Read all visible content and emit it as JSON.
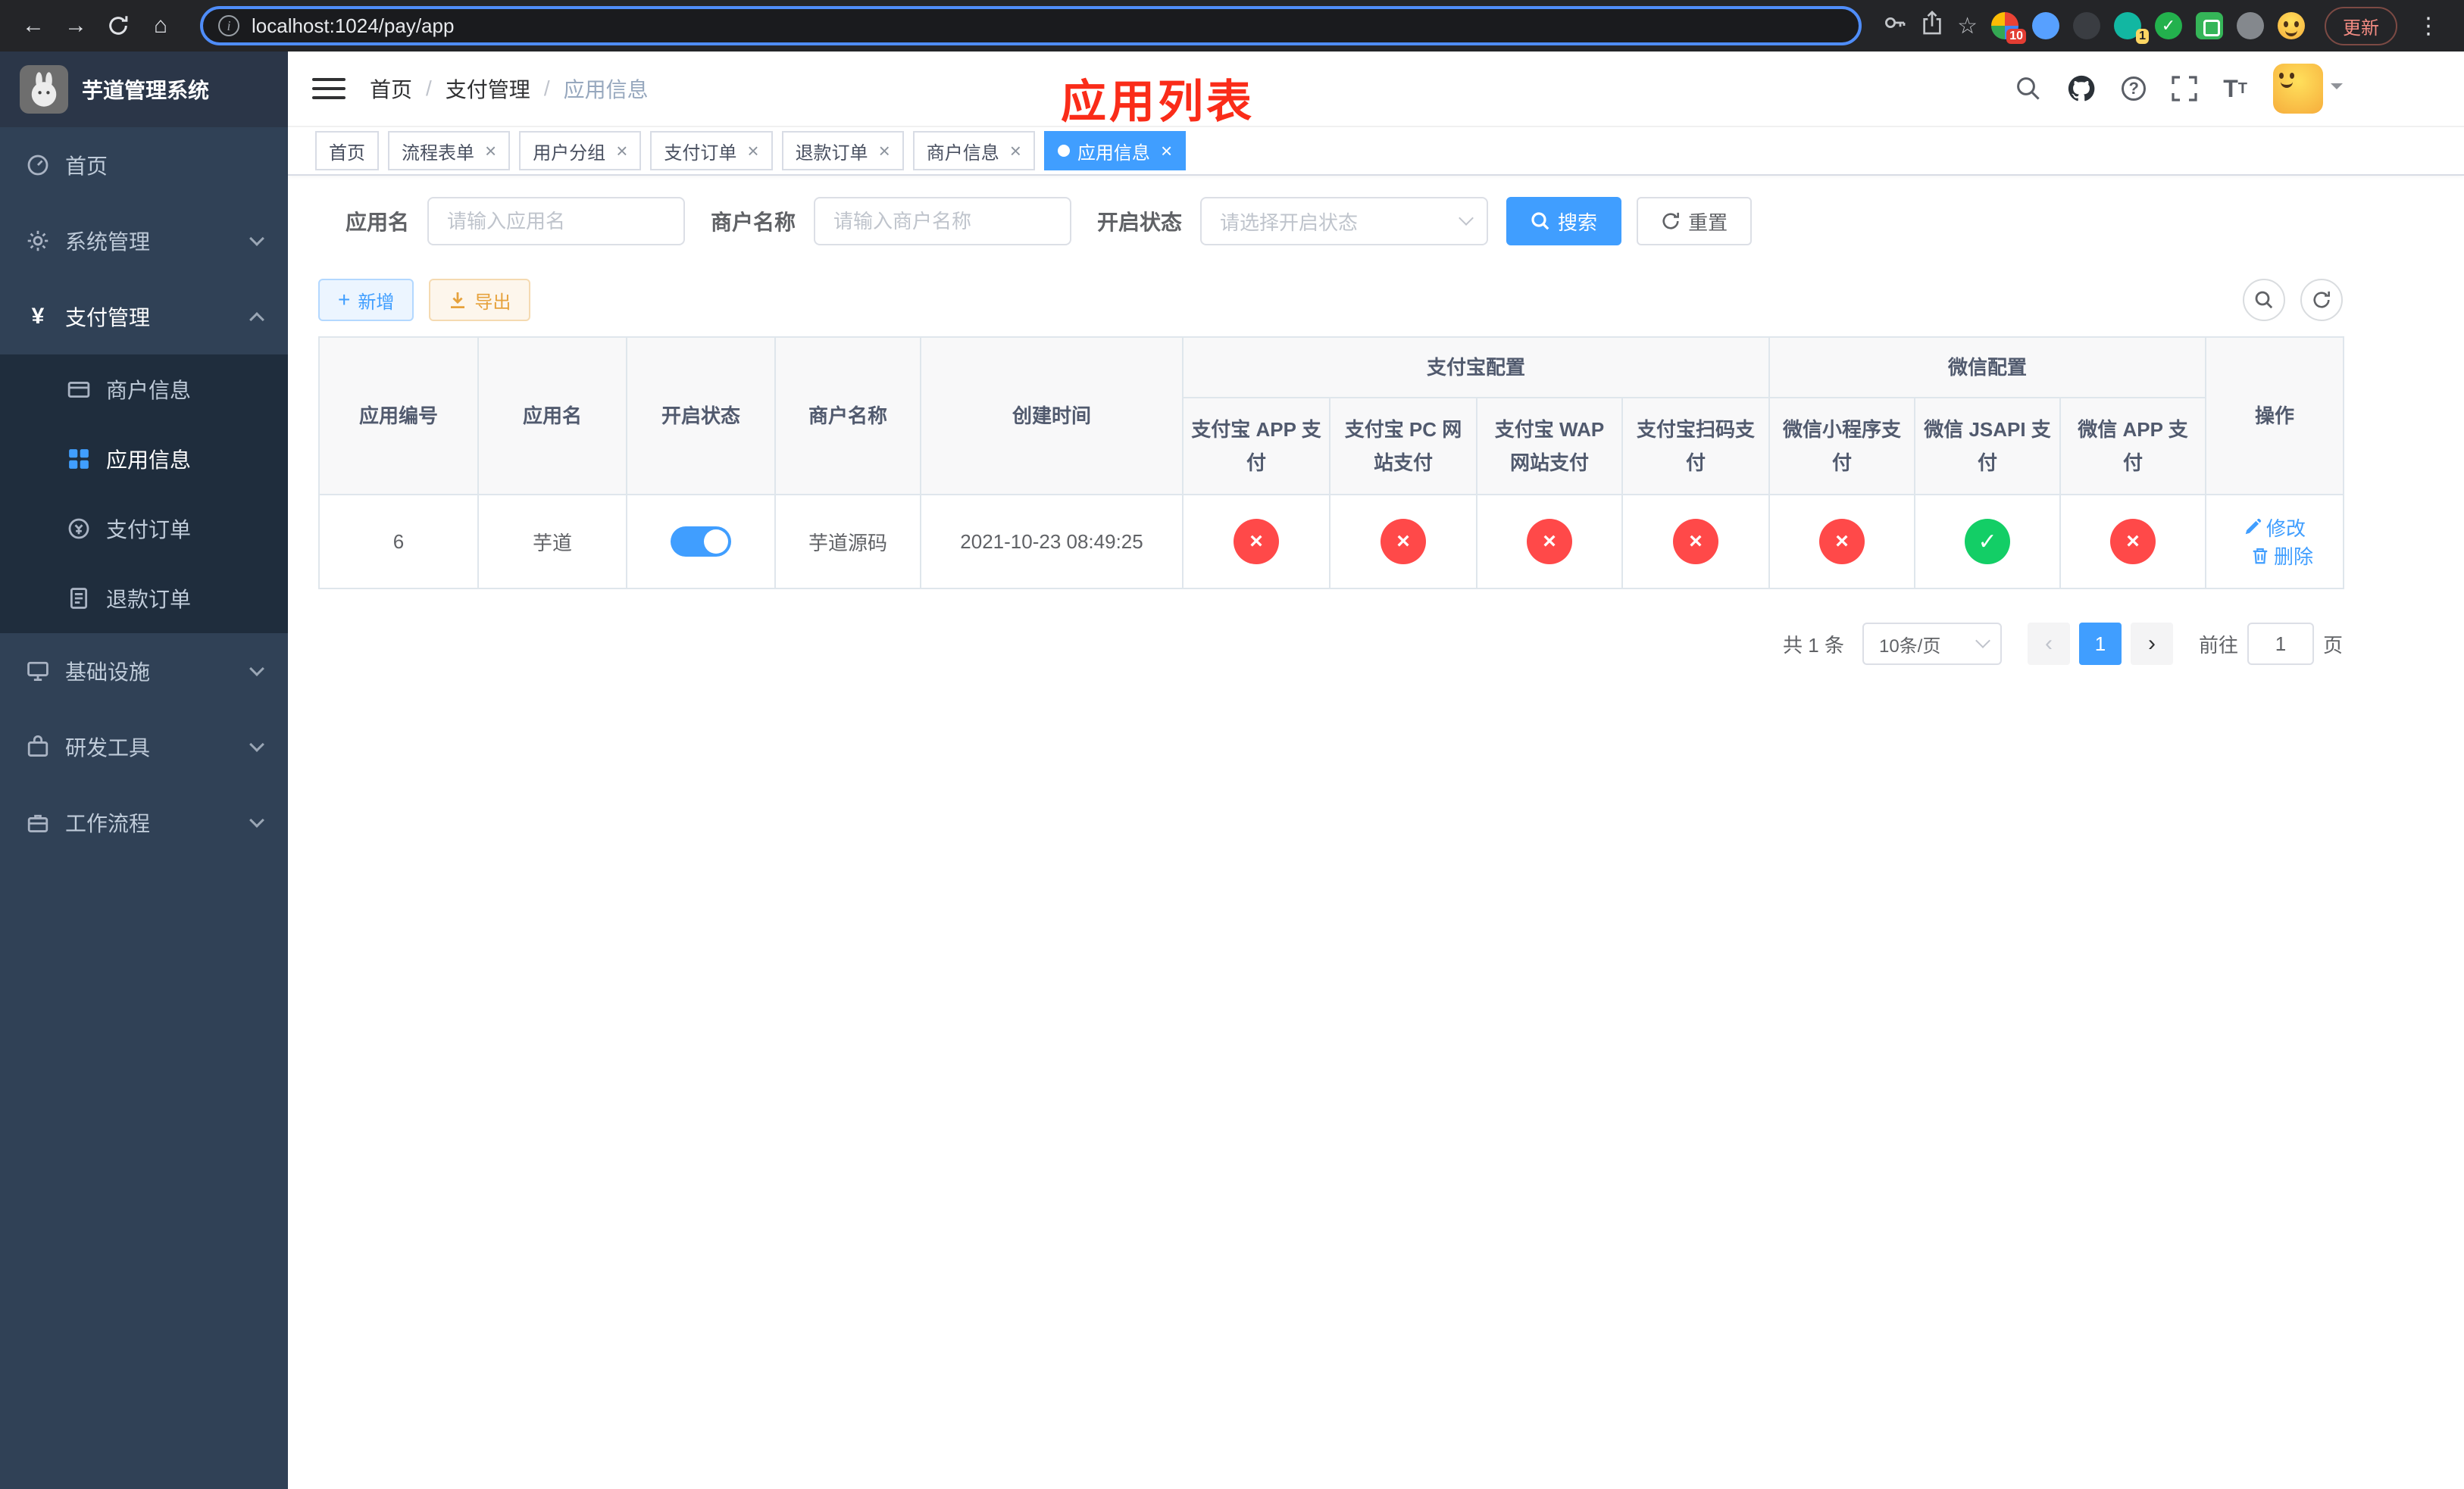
{
  "browser": {
    "url": "localhost:1024/pay/app",
    "update_label": "更新",
    "extension_badge_1": "10",
    "extension_badge_2": "1"
  },
  "sidebar": {
    "title": "芋道管理系统",
    "menu": [
      {
        "label": "首页"
      },
      {
        "label": "系统管理"
      },
      {
        "label": "支付管理"
      },
      {
        "label": "基础设施"
      },
      {
        "label": "研发工具"
      },
      {
        "label": "工作流程"
      }
    ],
    "payment_children": [
      {
        "label": "商户信息"
      },
      {
        "label": "应用信息"
      },
      {
        "label": "支付订单"
      },
      {
        "label": "退款订单"
      }
    ]
  },
  "navbar": {
    "breadcrumb": [
      "首页",
      "支付管理",
      "应用信息"
    ],
    "annotation": "应用列表"
  },
  "tags": [
    {
      "label": "首页"
    },
    {
      "label": "流程表单"
    },
    {
      "label": "用户分组"
    },
    {
      "label": "支付订单"
    },
    {
      "label": "退款订单"
    },
    {
      "label": "商户信息"
    },
    {
      "label": "应用信息"
    }
  ],
  "filters": {
    "app_name_label": "应用名",
    "app_name_placeholder": "请输入应用名",
    "merchant_label": "商户名称",
    "merchant_placeholder": "请输入商户名称",
    "status_label": "开启状态",
    "status_placeholder": "请选择开启状态",
    "search_button": "搜索",
    "reset_button": "重置"
  },
  "toolbar": {
    "add_button": "新增",
    "export_button": "导出"
  },
  "table": {
    "columns": {
      "app_id": "应用编号",
      "app_name": "应用名",
      "status": "开启状态",
      "merchant": "商户名称",
      "created": "创建时间",
      "actions": "操作"
    },
    "groups": {
      "alipay": "支付宝配置",
      "wechat": "微信配置"
    },
    "pay_columns": [
      "支付宝 APP 支付",
      "支付宝 PC 网站支付",
      "支付宝 WAP 网站支付",
      "支付宝扫码支付",
      "微信小程序支付",
      "微信 JSAPI 支付",
      "微信 APP 支付"
    ],
    "rows": [
      {
        "app_id": "6",
        "app_name": "芋道",
        "status_on": true,
        "merchant": "芋道源码",
        "created": "2021-10-23 08:49:25",
        "pay_status": [
          false,
          false,
          false,
          false,
          false,
          true,
          false
        ],
        "edit_label": "修改",
        "delete_label": "删除"
      }
    ]
  },
  "pagination": {
    "total": "共 1 条",
    "page_size": "10条/页",
    "current_page": "1",
    "goto_label": "前往",
    "goto_value": "1",
    "page_unit": "页"
  },
  "colors": {
    "primary": "#409EFF",
    "success": "#13ce66",
    "danger": "#ff4949",
    "warning": "#e6a23c",
    "sidebar_bg": "#304156",
    "annotation_red": "#fa2c19"
  }
}
